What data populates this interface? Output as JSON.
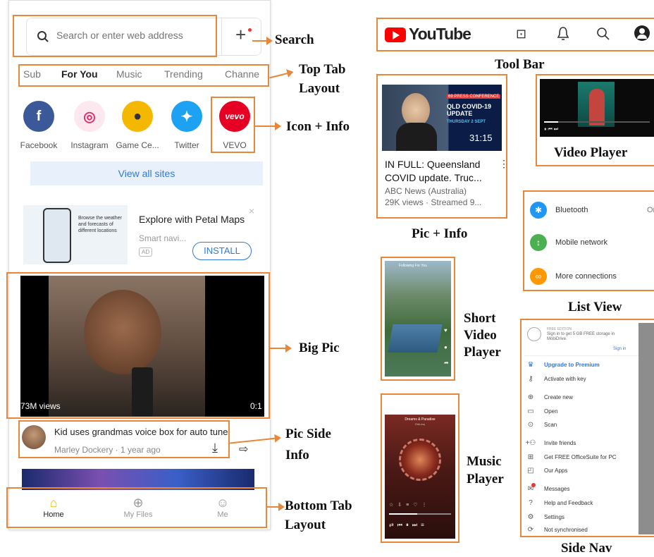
{
  "phone": {
    "search": {
      "placeholder": "Search or enter web address"
    },
    "tabs": [
      "Sub",
      "For You",
      "Music",
      "Trending",
      "Channe"
    ],
    "apps": [
      {
        "label": "Facebook",
        "glyph": "f",
        "color": "#3b5998"
      },
      {
        "label": "Instagram",
        "glyph": "◎",
        "color": "#e1306c"
      },
      {
        "label": "Game Ce...",
        "glyph": "●",
        "color": "#f5b800"
      },
      {
        "label": "Twitter",
        "glyph": "✦",
        "color": "#1da1f2"
      },
      {
        "label": "VEVO",
        "glyph": "vevo",
        "color": "#e60023"
      }
    ],
    "view_all": "View all sites",
    "ad": {
      "title": "Explore with Petal Maps",
      "subtitle": "Smart navi...",
      "badge": "AD",
      "install": "INSTALL",
      "thumb_text": "Browse the weather and forecasts of different locations"
    },
    "video": {
      "views": "73M views",
      "duration": "0:1"
    },
    "pic_side": {
      "title": "Kid uses grandmas voice box for auto tune",
      "meta": "Marley Dockery · 1 year ago"
    },
    "bottom_tabs": [
      "Home",
      "My Files",
      "Me"
    ]
  },
  "youtube": {
    "brand": "YouTube"
  },
  "pic_info": {
    "badge": "69 PRESS CONFERENCE",
    "headline1": "QLD COVID-19",
    "headline2": "UPDATE",
    "date": "THURSDAY 2 SEPT",
    "duration": "31:15",
    "title": "IN FULL: Queensland COVID update. Truc...",
    "channel": "ABC News (Australia)",
    "meta": "29K views · Streamed 9..."
  },
  "short_video": {
    "tabs": "Following   For You"
  },
  "music_player": {
    "title": "Dreams & Paradise",
    "artist": "Erik.mq"
  },
  "list_view": [
    {
      "label": "Bluetooth",
      "value": "On",
      "color": "#2196f3",
      "glyph": "✱"
    },
    {
      "label": "Mobile network",
      "value": "",
      "color": "#4caf50",
      "glyph": "↕"
    },
    {
      "label": "More connections",
      "value": "",
      "color": "#ff9800",
      "glyph": "∞"
    }
  ],
  "side_nav": {
    "edition": "FREE EDITION",
    "promo": "Sign in to get 5 GB FREE storage in MobiDrive.",
    "signin": "Sign in",
    "items": [
      {
        "label": "Upgrade to Premium",
        "glyph": "♛",
        "color": "#2f7bd6"
      },
      {
        "label": "Activate with key",
        "glyph": "⚷",
        "color": "#333"
      },
      {
        "label": "Create new",
        "glyph": "⊕",
        "color": "#333"
      },
      {
        "label": "Open",
        "glyph": "▭",
        "color": "#333"
      },
      {
        "label": "Scan",
        "glyph": "⊙",
        "color": "#333"
      },
      {
        "label": "Invite friends",
        "glyph": "+⚇",
        "color": "#333"
      },
      {
        "label": "Get FREE OfficeSuite for PC",
        "glyph": "⊞",
        "color": "#333"
      },
      {
        "label": "Our Apps",
        "glyph": "◰",
        "color": "#333"
      },
      {
        "label": "Messages",
        "glyph": "✉",
        "color": "#333"
      },
      {
        "label": "Help and Feedback",
        "glyph": "?",
        "color": "#333"
      },
      {
        "label": "Settings",
        "glyph": "⚙",
        "color": "#333"
      },
      {
        "label": "Not synchronised",
        "glyph": "⟳",
        "color": "#333"
      }
    ]
  },
  "labels": {
    "search": "Search",
    "top_tab": "Top Tab",
    "layout": "Layout",
    "icon_info": "Icon + Info",
    "big_pic": "Big Pic",
    "pic_side_1": "Pic Side",
    "pic_side_2": "Info",
    "bottom_tab": "Bottom Tab",
    "tool_bar": "Tool Bar",
    "video_player": "Video Player",
    "pic_info": "Pic + Info",
    "list_view": "List View",
    "short_1": "Short",
    "short_2": "Video",
    "short_3": "Player",
    "music_1": "Music",
    "music_2": "Player",
    "side_nav": "Side Nav"
  }
}
